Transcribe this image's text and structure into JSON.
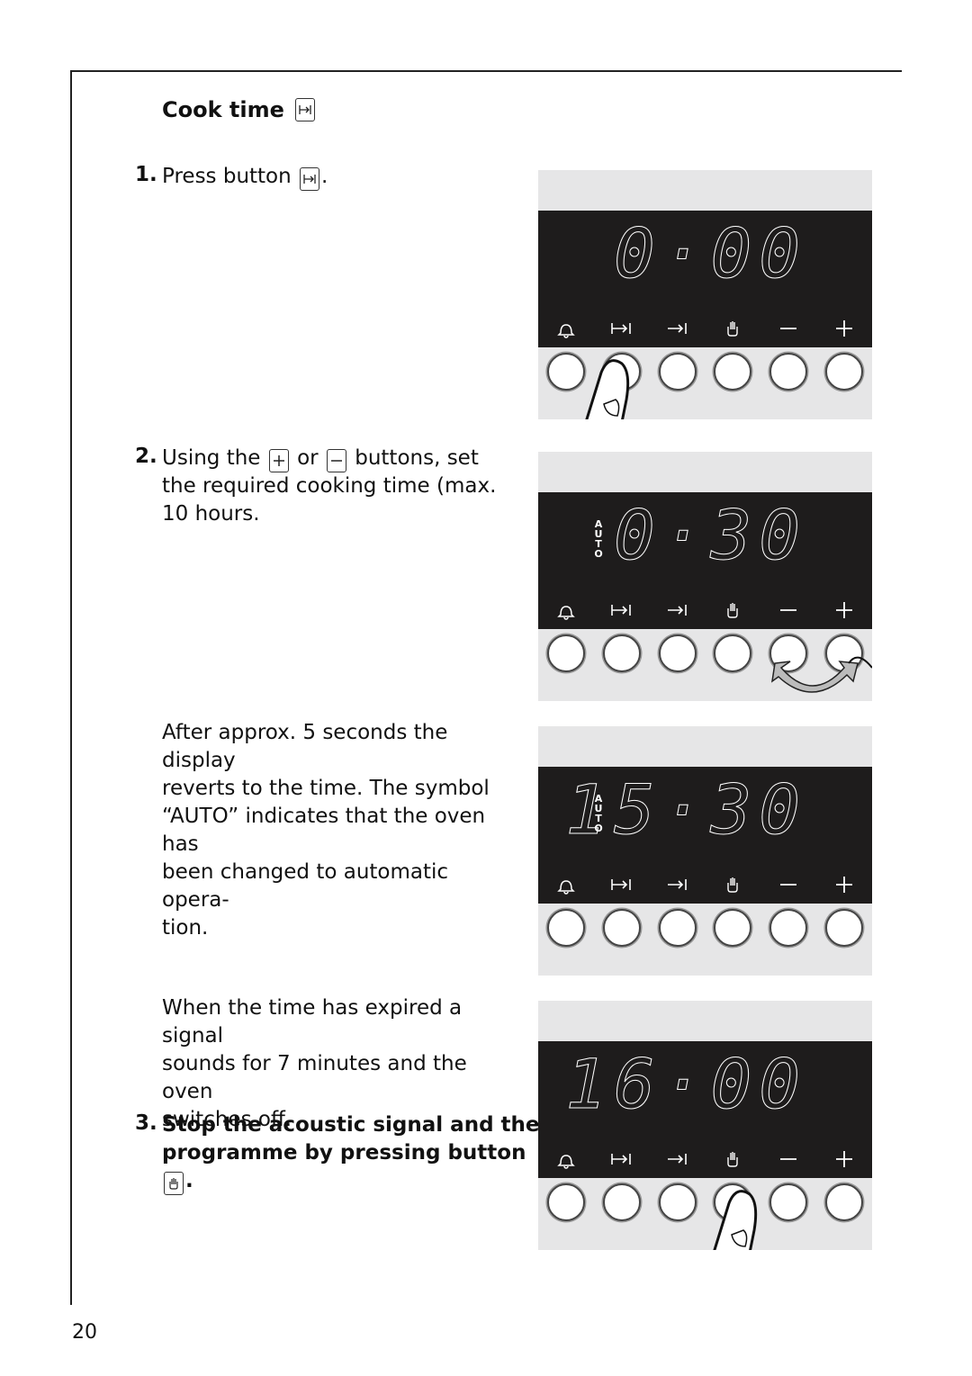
{
  "heading": {
    "title": "Cook time",
    "icon": "cook-time-icon"
  },
  "steps": [
    {
      "number": "1.",
      "text_before": "Press button",
      "text_after": "."
    },
    {
      "number": "2.",
      "line1_a": "Using the",
      "line1_b": "or",
      "line1_c": "buttons, set",
      "line2": "the required cooking time (max.",
      "line3": "10 hours."
    },
    {
      "para": [
        "After approx. 5 seconds the display",
        "reverts to the time. The symbol",
        "“AUTO” indicates that the oven has",
        "been changed to automatic opera-",
        "tion."
      ]
    },
    {
      "para": [
        "When the time has expired a signal",
        "sounds for 7 minutes and the oven",
        "switches off."
      ]
    },
    {
      "number": "3.",
      "line1": "Stop the acoustic signal and the",
      "line2": "programme by pressing button",
      "end": "."
    }
  ],
  "panels": [
    {
      "display": "0·00",
      "auto": "",
      "action": "press cook-time button"
    },
    {
      "display": "0·30",
      "auto": "AUTO",
      "action": "press plus/minus buttons"
    },
    {
      "display": "15·30",
      "auto": "AUTO",
      "action": ""
    },
    {
      "display": "16·00",
      "auto": "",
      "action": "press stop button"
    }
  ],
  "control_icons": [
    "bell-icon",
    "cook-time-icon",
    "end-time-icon",
    "hand-stop-icon",
    "minus-icon",
    "plus-icon"
  ],
  "page_number": "20"
}
